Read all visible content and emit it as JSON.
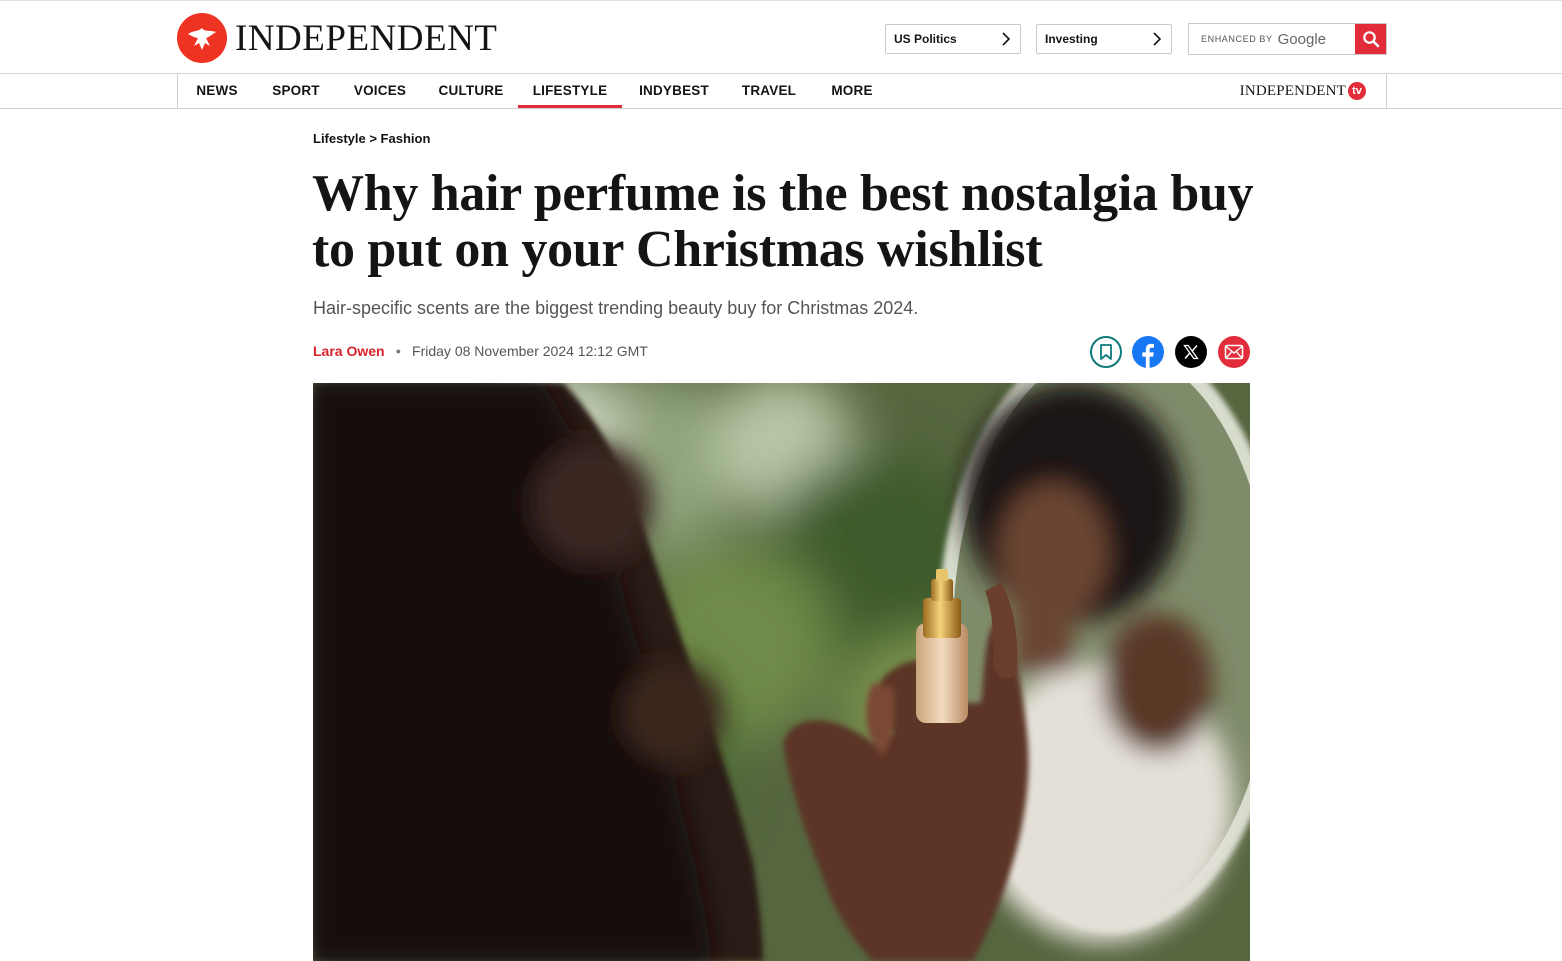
{
  "masthead": {
    "logo_text": "INDEPENDENT",
    "brand_color": "#e32c39",
    "quick_links": [
      {
        "label": "US Politics"
      },
      {
        "label": "Investing"
      }
    ],
    "search": {
      "enhanced_label": "ENHANCED BY",
      "google_label": "Google"
    }
  },
  "nav": {
    "items": [
      {
        "label": "NEWS",
        "active": false
      },
      {
        "label": "SPORT",
        "active": false
      },
      {
        "label": "VOICES",
        "active": false
      },
      {
        "label": "CULTURE",
        "active": false
      },
      {
        "label": "LIFESTYLE",
        "active": true
      },
      {
        "label": "INDYBEST",
        "active": false
      },
      {
        "label": "TRAVEL",
        "active": false
      },
      {
        "label": "MORE",
        "active": false
      }
    ],
    "tv_logo": {
      "word": "INDEPENDENT",
      "badge": "tv"
    }
  },
  "article": {
    "breadcrumb": "Lifestyle > Fashion",
    "headline": "Why hair perfume is the best nostalgia buy to put on your Christmas wishlist",
    "standfirst": "Hair-specific scents are the biggest trending beauty buy for Christmas 2024.",
    "author": "Lara Owen",
    "date": "Friday 08 November 2024 12:12 GMT",
    "share_icons": [
      "bookmark-icon",
      "facebook-icon",
      "x-icon",
      "mail-icon"
    ]
  }
}
